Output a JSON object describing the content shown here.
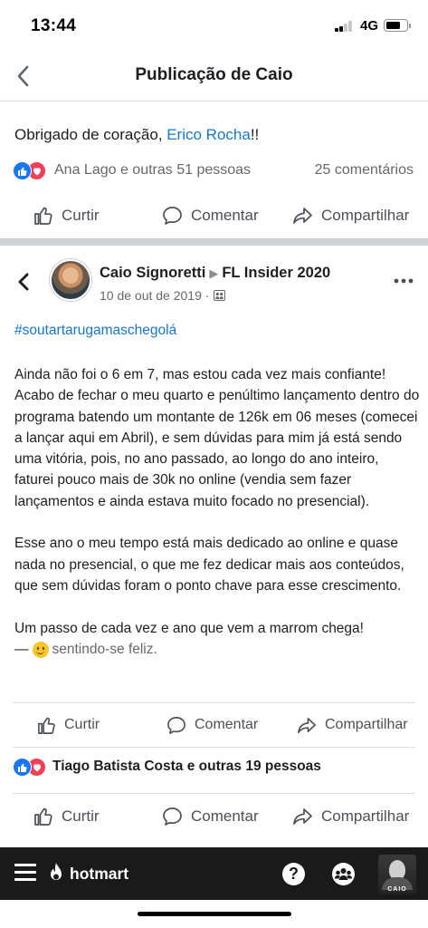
{
  "status_bar": {
    "time": "13:44",
    "network": "4G"
  },
  "header": {
    "title": "Publicação de Caio"
  },
  "comment": {
    "text_before": "Obrigado de coração, ",
    "mention": "Erico Rocha",
    "text_after": "!!",
    "reactions_text": "Ana Lago e outras 51 pessoas",
    "comments_count": "25 comentários"
  },
  "actions": {
    "like": "Curtir",
    "comment": "Comentar",
    "share": "Compartilhar"
  },
  "post": {
    "author": "Caio Signoretti",
    "group": "FL Insider 2020",
    "date": "10 de out de 2019 ·",
    "hashtag": "#soutartarugamaschegolá",
    "paragraphs": [
      "Ainda não foi o 6 em 7, mas estou cada vez mais confiante! Acabo de fechar o meu quarto e penúltimo lançamento dentro do programa batendo um montante de 126k em 06 meses (comecei a lançar aqui em Abril), e sem dúvidas para mim já está sendo uma vitória, pois, no ano passado, ao longo do ano inteiro, faturei pouco mais de 30k no online (vendia sem fazer lançamentos e ainda estava muito focado no presencial).",
      "Esse ano o meu tempo está mais dedicado ao online e quase nada no presencial, o que me fez dedicar mais aos conteúdos, que sem dúvidas foram o ponto chave para esse crescimento.",
      "Um passo de cada vez e ano que vem a marrom chega!"
    ],
    "feeling_dash": "—",
    "feeling": "sentindo-se feliz.",
    "reactions_text": "Tiago Batista Costa e outras 19 pessoas"
  },
  "bottom_nav": {
    "brand": "hotmart",
    "help_glyph": "?",
    "profile_label": "CAIO"
  },
  "colors": {
    "link": "#1877c9",
    "like": "#1877f2",
    "love": "#f33e58",
    "nav_bg": "#1a1a1a"
  },
  "icons": [
    "back-arrow-icon",
    "like-reaction-icon",
    "love-reaction-icon",
    "thumbs-up-icon",
    "comment-icon",
    "share-icon",
    "more-icon",
    "group-icon",
    "smiley-icon",
    "menu-icon",
    "hotmart-flame-icon",
    "help-icon",
    "community-icon"
  ]
}
